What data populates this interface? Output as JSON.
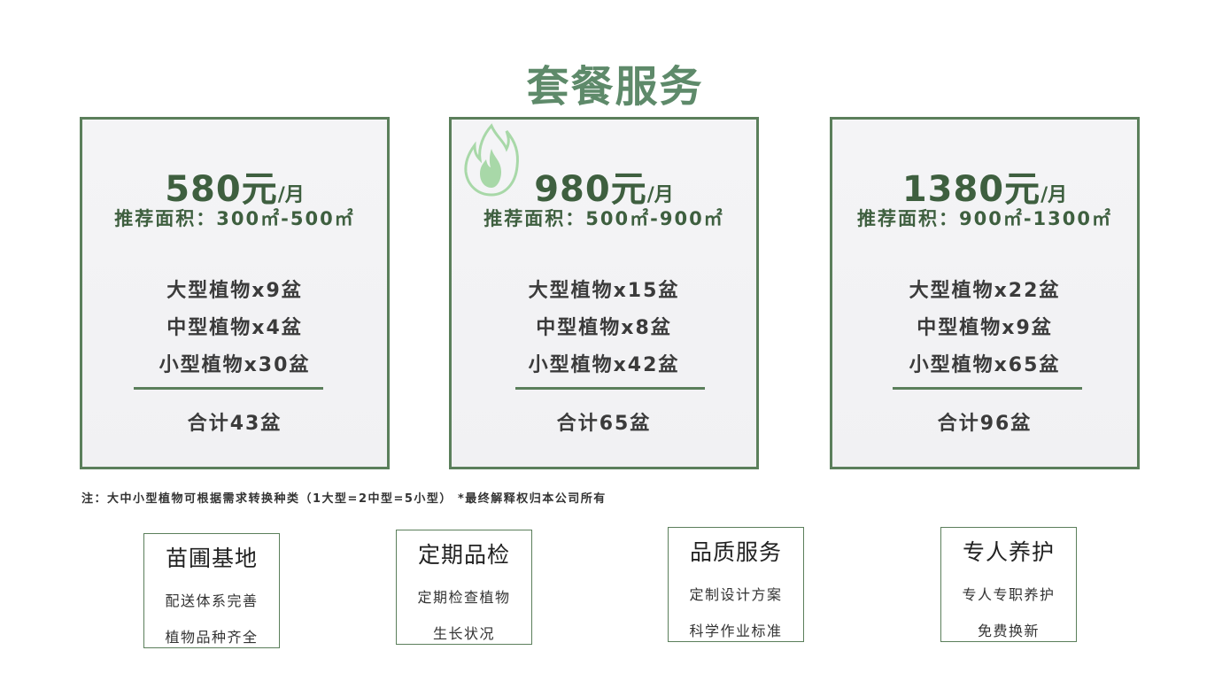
{
  "title": "套餐服务",
  "plans": [
    {
      "price": "580元",
      "unit": "/月",
      "area": "推荐面积：300㎡-500㎡",
      "large": "大型植物x9盆",
      "medium": "中型植物x4盆",
      "small": "小型植物x30盆",
      "total": "合计43盆"
    },
    {
      "price": "980元",
      "unit": "/月",
      "area": "推荐面积：500㎡-900㎡",
      "large": "大型植物x15盆",
      "medium": "中型植物x8盆",
      "small": "小型植物x42盆",
      "total": "合计65盆",
      "badge_icon": "flame-icon"
    },
    {
      "price": "1380元",
      "unit": "/月",
      "area": "推荐面积：900㎡-1300㎡",
      "large": "大型植物x22盆",
      "medium": "中型植物x9盆",
      "small": "小型植物x65盆",
      "total": "合计96盆"
    }
  ],
  "note": "注：大中小型植物可根据需求转换种类（1大型=2中型=5小型） *最终解释权归本公司所有",
  "features": [
    {
      "title": "苗圃基地",
      "line1": "配送体系完善",
      "line2": "植物品种齐全"
    },
    {
      "title": "定期品检",
      "line1": "定期检查植物",
      "line2": "生长状况"
    },
    {
      "title": "品质服务",
      "line1": "定制设计方案",
      "line2": "科学作业标准"
    },
    {
      "title": "专人养护",
      "line1": "专人专职养护",
      "line2": "免费换新"
    }
  ],
  "colors": {
    "title": "#5e8a6a",
    "accent": "#3e5f3f",
    "border": "#5b7f5b",
    "flame": "#a8d8a8"
  }
}
